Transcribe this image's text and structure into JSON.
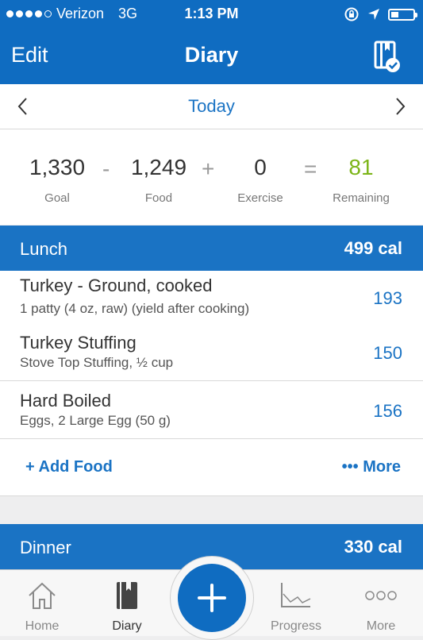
{
  "status": {
    "carrier": "Verizon",
    "network": "3G",
    "time": "1:13 PM"
  },
  "nav": {
    "edit": "Edit",
    "title": "Diary"
  },
  "date": {
    "label": "Today"
  },
  "summary": {
    "goal": {
      "value": "1,330",
      "label": "Goal"
    },
    "minus": "-",
    "food": {
      "value": "1,249",
      "label": "Food"
    },
    "plus": "+",
    "exercise": {
      "value": "0",
      "label": "Exercise"
    },
    "equals": "=",
    "remaining": {
      "value": "81",
      "label": "Remaining"
    },
    "remaining_color": "#7cb518"
  },
  "lunch": {
    "name": "Lunch",
    "cal": "499 cal",
    "items": [
      {
        "title": "Turkey - Ground, cooked",
        "sub": "1 patty (4 oz, raw) (yield after cooking)",
        "cals": "193"
      },
      {
        "title": "Turkey Stuffing",
        "sub": "Stove Top Stuffing, ½ cup",
        "cals": "150"
      },
      {
        "title": "Hard Boiled",
        "sub": "Eggs, 2 Large Egg (50 g)",
        "cals": "156"
      }
    ],
    "add_food": "+ Add Food",
    "more": "••• More"
  },
  "dinner": {
    "name": "Dinner",
    "cal": "330 cal"
  },
  "tabs": [
    {
      "label": "Home",
      "icon": "home-icon"
    },
    {
      "label": "Diary",
      "icon": "diary-icon"
    },
    {
      "label": "Progress",
      "icon": "progress-icon"
    },
    {
      "label": "More",
      "icon": "more-dots-icon"
    }
  ],
  "colors": {
    "nav_blue": "#0f6cc1",
    "header_blue": "#1a73c4",
    "accent_green": "#7cb518"
  }
}
